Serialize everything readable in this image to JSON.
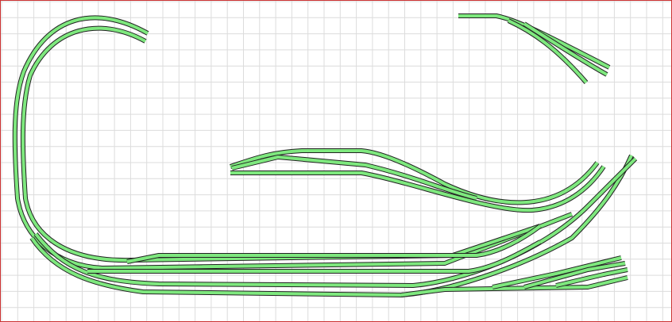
{
  "colors": {
    "track_fill": "#7ee87e",
    "track_outline": "#222222",
    "grid_line": "#dcdcdc",
    "frame_border": "#cc3333",
    "background": "#ffffff"
  },
  "canvas": {
    "grid": true
  }
}
